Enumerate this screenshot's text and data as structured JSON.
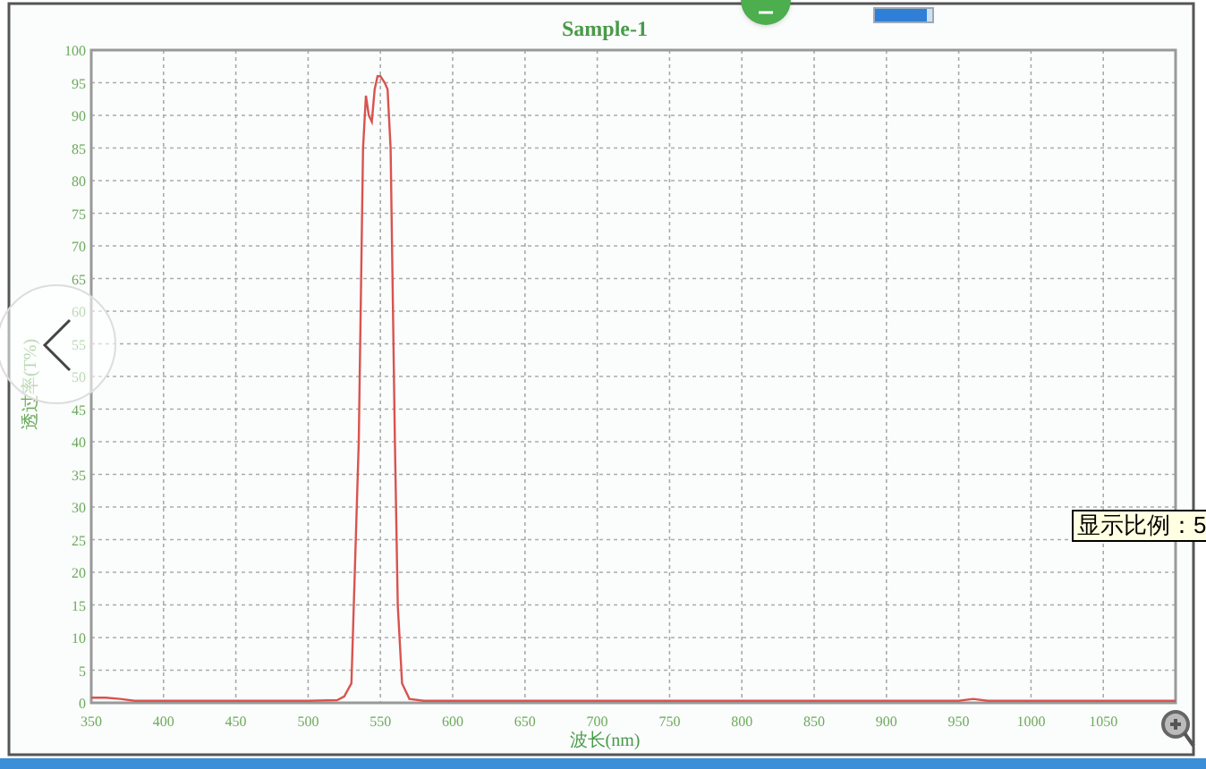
{
  "chart": {
    "title": "Sample-1",
    "chart_data": {
      "type": "line",
      "grid": true,
      "xlabel": "波长(nm)",
      "ylabel": "透过率(T%)",
      "xlim": [
        350,
        1100
      ],
      "ylim": [
        0,
        100
      ],
      "xticks": [
        350,
        400,
        450,
        500,
        550,
        600,
        650,
        700,
        750,
        800,
        850,
        900,
        950,
        1000,
        1050
      ],
      "yticks": [
        0,
        5,
        10,
        15,
        20,
        25,
        30,
        35,
        40,
        45,
        50,
        55,
        60,
        65,
        70,
        75,
        80,
        85,
        90,
        95,
        100
      ],
      "x": [
        350,
        360,
        370,
        380,
        400,
        450,
        500,
        520,
        525,
        530,
        535,
        538,
        540,
        542,
        544,
        546,
        548,
        550,
        553,
        555,
        557,
        558,
        560,
        562,
        565,
        570,
        580,
        600,
        700,
        800,
        900,
        950,
        960,
        970,
        1000,
        1050,
        1100
      ],
      "series": [
        {
          "color": "#d9534f",
          "values": [
            0.8,
            0.8,
            0.6,
            0.3,
            0.3,
            0.3,
            0.3,
            0.4,
            1,
            3,
            40,
            85,
            93,
            90,
            89,
            94,
            96,
            96,
            95,
            94,
            85,
            70,
            40,
            15,
            3,
            0.6,
            0.3,
            0.3,
            0.3,
            0.3,
            0.3,
            0.3,
            0.6,
            0.3,
            0.3,
            0.3,
            0.3
          ]
        }
      ]
    }
  },
  "progress": {
    "level": 0.9
  },
  "tooltip": {
    "text": "显示比例：5"
  }
}
